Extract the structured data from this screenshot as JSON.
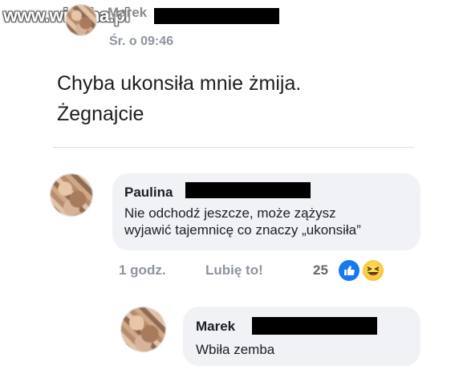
{
  "watermark": "www.wiocha.pl",
  "post": {
    "author_visible": "Marek",
    "time": "Śr. o 09:46",
    "text_line1": "Chyba ukonsiła mnie żmija.",
    "text_line2": "Żegnajcie"
  },
  "comments": [
    {
      "author": "Paulina",
      "text_line1": "Nie odchodź jeszcze, może zążysz",
      "text_line2": "wyjawić tajemnicę co znaczy „ukonsiła”",
      "time": "1 godz.",
      "like_label": "Lubię to!",
      "reaction_count": "25"
    },
    {
      "author": "Marek",
      "text": "Wbiła zemba"
    }
  ],
  "colors": {
    "bubble": "#f0f2f5",
    "meta": "#8d949e",
    "like_blue": "#1877f2",
    "redaction": "#000000"
  }
}
